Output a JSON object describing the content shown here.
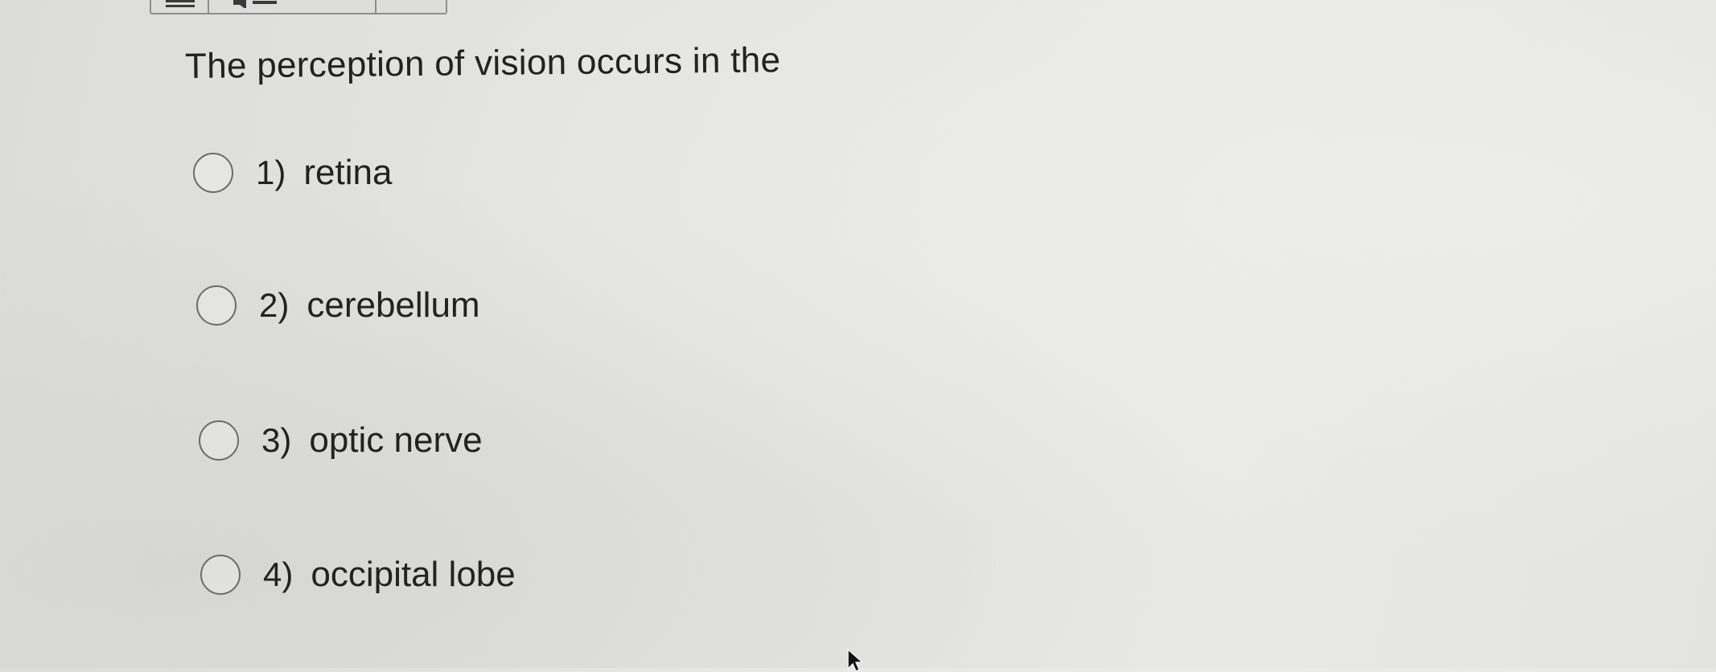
{
  "question": {
    "text": "The perception of vision occurs in the"
  },
  "options": [
    {
      "number": "1)",
      "text": "retina"
    },
    {
      "number": "2)",
      "text": "cerebellum"
    },
    {
      "number": "3)",
      "text": "optic nerve"
    },
    {
      "number": "4)",
      "text": "occipital lobe"
    }
  ],
  "icons": {
    "toolbar_menu": "menu-icon",
    "toolbar_audio": "speaker-icon",
    "pointer": "mouse-cursor-icon"
  },
  "colors": {
    "text": "#222222",
    "radio_border": "#6b6b6b",
    "background": "#e4e4e1"
  }
}
